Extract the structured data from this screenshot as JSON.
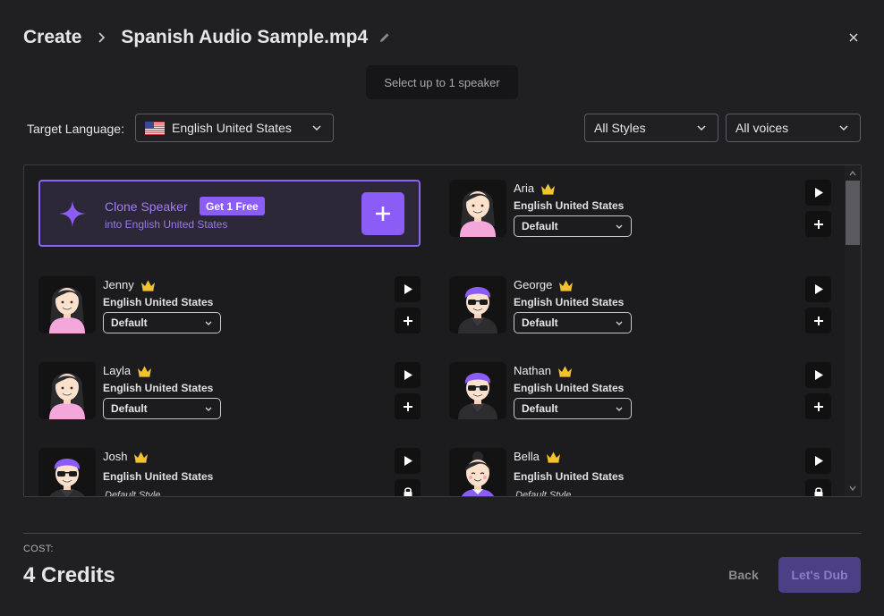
{
  "header": {
    "create_label": "Create",
    "file_name": "Spanish Audio Sample.mp4"
  },
  "hint_text": "Select up to 1 speaker",
  "filters": {
    "target_language_label": "Target Language:",
    "language_value": "English United States",
    "styles_value": "All Styles",
    "voices_value": "All voices"
  },
  "clone": {
    "title": "Clone Speaker",
    "badge": "Get 1 Free",
    "subtitle": "into English United States"
  },
  "voices": [
    {
      "name": "Aria",
      "language": "English United States",
      "style": "Default",
      "avatar": "female"
    },
    {
      "name": "Jenny",
      "language": "English United States",
      "style": "Default",
      "avatar": "female"
    },
    {
      "name": "George",
      "language": "English United States",
      "style": "Default",
      "avatar": "male"
    },
    {
      "name": "Layla",
      "language": "English United States",
      "style": "Default",
      "avatar": "female"
    },
    {
      "name": "Nathan",
      "language": "English United States",
      "style": "Default",
      "avatar": "male"
    },
    {
      "name": "Josh",
      "language": "English United States",
      "style": "Default Style",
      "avatar": "male",
      "locked": true
    },
    {
      "name": "Bella",
      "language": "English United States",
      "style": "Default Style",
      "avatar": "female-bun",
      "locked": true
    }
  ],
  "footer": {
    "cost_label": "COST:",
    "cost_value": "4 Credits",
    "back_label": "Back",
    "dub_label": "Let's Dub"
  },
  "colors": {
    "accent": "#8b5cf6",
    "crown": "#f2c230",
    "background": "#202022"
  }
}
